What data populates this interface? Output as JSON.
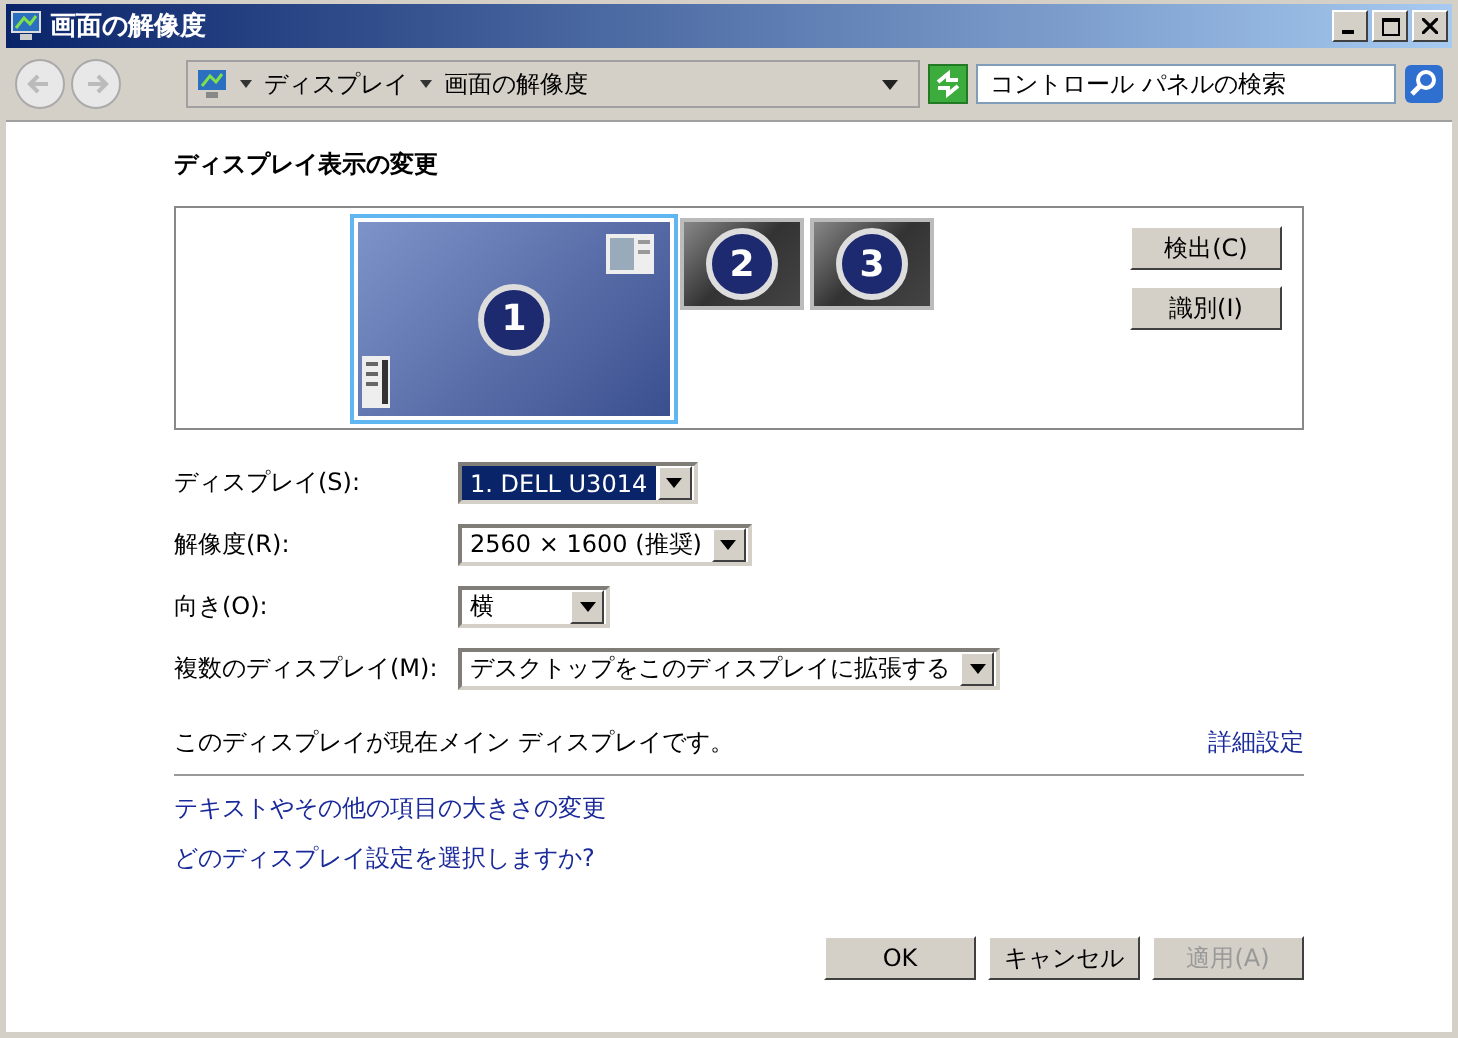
{
  "window": {
    "title": "画面の解像度"
  },
  "breadcrumb": [
    "ディスプレイ",
    "画面の解像度"
  ],
  "search": {
    "placeholder": "コントロール パネルの検索"
  },
  "heading": "ディスプレイ表示の変更",
  "monitors": [
    {
      "number": "1",
      "selected": true
    },
    {
      "number": "2",
      "selected": false
    },
    {
      "number": "3",
      "selected": false
    }
  ],
  "side_buttons": [
    "検出(C)",
    "識別(I)"
  ],
  "settings": [
    {
      "label": "ディスプレイ(S):",
      "value": "1. DELL U3014",
      "focused": true
    },
    {
      "label": "解像度(R):",
      "value": "2560 × 1600 (推奨)",
      "focused": false
    },
    {
      "label": "向き(O):",
      "value": "横",
      "focused": false
    },
    {
      "label": "複数のディスプレイ(M):",
      "value": "デスクトップをこのディスプレイに拡張する",
      "focused": false
    }
  ],
  "status_text": "このディスプレイが現在メイン ディスプレイです。",
  "advanced_link": "詳細設定",
  "links": [
    "テキストやその他の項目の大きさの変更",
    "どのディスプレイ設定を選択しますか?"
  ],
  "buttons": [
    {
      "label": "OK",
      "disabled": false
    },
    {
      "label": "キャンセル",
      "disabled": false
    },
    {
      "label": "適用(A)",
      "disabled": true
    }
  ]
}
